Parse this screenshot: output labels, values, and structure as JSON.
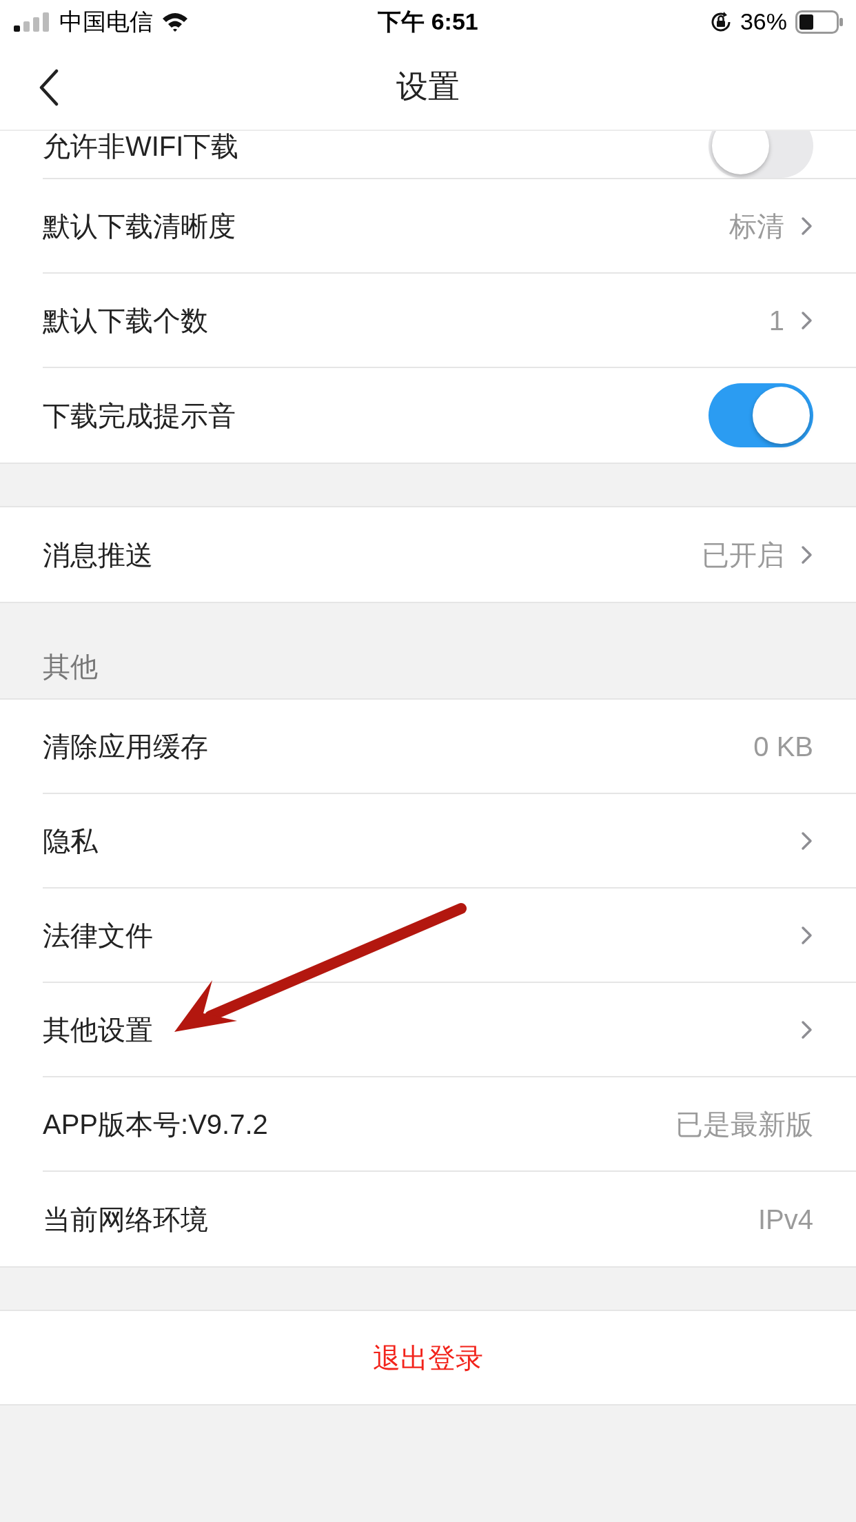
{
  "status_bar": {
    "carrier": "中国电信",
    "time": "下午 6:51",
    "battery": "36%"
  },
  "nav": {
    "title": "设置"
  },
  "groups": [
    {
      "rows": [
        {
          "kind": "toggle",
          "label": "允许非WIFI下载",
          "on": false
        },
        {
          "kind": "value",
          "label": "默认下载清晰度",
          "value": "标清"
        },
        {
          "kind": "value",
          "label": "默认下载个数",
          "value": "1"
        },
        {
          "kind": "toggle",
          "label": "下载完成提示音",
          "on": true
        }
      ]
    },
    {
      "rows": [
        {
          "kind": "value",
          "label": "消息推送",
          "value": "已开启"
        }
      ]
    },
    {
      "header": "其他",
      "rows": [
        {
          "kind": "info",
          "label": "清除应用缓存",
          "value": "0 KB"
        },
        {
          "kind": "link",
          "label": "隐私"
        },
        {
          "kind": "link",
          "label": "法律文件"
        },
        {
          "kind": "link",
          "label": "其他设置"
        },
        {
          "kind": "info",
          "label": "APP版本号:V9.7.2",
          "value": "已是最新版"
        },
        {
          "kind": "info",
          "label": "当前网络环境",
          "value": "IPv4"
        }
      ]
    }
  ],
  "logout": {
    "label": "退出登录"
  }
}
